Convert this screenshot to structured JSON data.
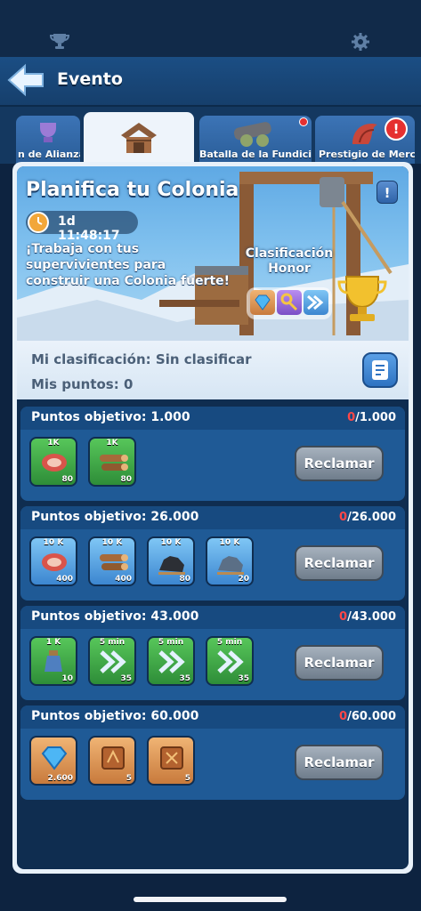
{
  "header": {
    "title": "Evento"
  },
  "tabs": [
    {
      "label": "n de Alianzas",
      "active": false
    },
    {
      "label": "",
      "active": true
    },
    {
      "label": "Batalla de la Fundición",
      "active": false,
      "dot": true
    },
    {
      "label": "Prestigio de Merce",
      "active": false,
      "alert": "!"
    }
  ],
  "event": {
    "title": "Planifica tu Colonia",
    "info": "!",
    "timer": "1d 11:48:17",
    "description": "¡Trabaja con tus supervivientes para construir una Colonia fuerte!",
    "ranking_label": "Clasificación Honor"
  },
  "ranking": {
    "my_rank_label": "Mi clasificación:",
    "my_rank_value": "Sin clasificar",
    "my_points_label": "Mis puntos:",
    "my_points_value": "0"
  },
  "rewards": [
    {
      "target_label": "Puntos objetivo: 1.000",
      "current": "0",
      "goal": "/1.000",
      "claim_label": "Reclamar",
      "items": [
        {
          "top": "1K",
          "qty": "80",
          "icon": "meat-icon",
          "style": "green"
        },
        {
          "top": "1K",
          "qty": "80",
          "icon": "wood-icon",
          "style": "green"
        }
      ]
    },
    {
      "target_label": "Puntos objetivo: 26.000",
      "current": "0",
      "goal": "/26.000",
      "claim_label": "Reclamar",
      "items": [
        {
          "top": "10 K",
          "qty": "400",
          "icon": "meat-icon",
          "style": "blue"
        },
        {
          "top": "10 K",
          "qty": "400",
          "icon": "wood-icon",
          "style": "blue"
        },
        {
          "top": "10 K",
          "qty": "80",
          "icon": "coal-icon",
          "style": "blue"
        },
        {
          "top": "10 K",
          "qty": "20",
          "icon": "iron-icon",
          "style": "blue"
        }
      ]
    },
    {
      "target_label": "Puntos objetivo: 43.000",
      "current": "0",
      "goal": "/43.000",
      "claim_label": "Reclamar",
      "items": [
        {
          "top": "1 K",
          "qty": "10",
          "icon": "exp-potion-icon",
          "style": "green"
        },
        {
          "top": "5 min",
          "qty": "35",
          "icon": "speedup-icon",
          "style": "green"
        },
        {
          "top": "5 min",
          "qty": "35",
          "icon": "speedup-icon",
          "style": "green"
        },
        {
          "top": "5 min",
          "qty": "35",
          "icon": "speedup-icon",
          "style": "green"
        }
      ]
    },
    {
      "target_label": "Puntos objetivo: 60.000",
      "current": "0",
      "goal": "/60.000",
      "claim_label": "Reclamar",
      "items": [
        {
          "top": "",
          "qty": "2.600",
          "icon": "gem-icon",
          "style": "orange"
        },
        {
          "top": "",
          "qty": "5",
          "icon": "manual-icon",
          "style": "orange"
        },
        {
          "top": "",
          "qty": "5",
          "icon": "manual-icon",
          "style": "orange"
        }
      ]
    }
  ],
  "colors": {
    "accent": "#1f5a96",
    "progress_zero": "#ff4747",
    "background": "#0d2340"
  }
}
